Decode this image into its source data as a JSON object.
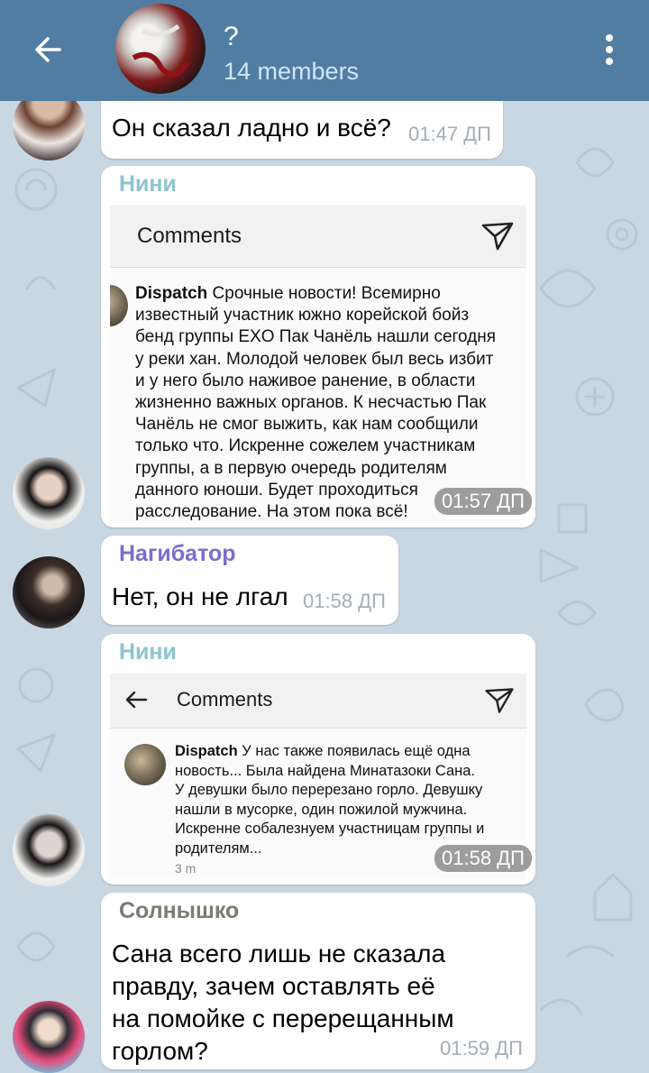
{
  "header": {
    "title": "?",
    "subtitle": "14 members"
  },
  "messages": [
    {
      "text": "Он сказал ладно и всё?",
      "time": "01:47 ДП"
    },
    {
      "sender": "Нини",
      "sender_color": "#8cc4d0",
      "time": "01:57 ДП",
      "screenshot": {
        "title": "Comments",
        "author": "Dispatch",
        "body_lines": [
          "Срочные новости! Всемирно",
          "известный участник южно корейской бойз",
          "бенд группы EXO Пак Чанёль нашли сегодня",
          "у реки хан. Молодой человек был весь избит",
          "и у него было наживое ранение, в области",
          "жизненно важных органов. К несчастью Пак",
          "Чанёль не смог выжить, как нам сообщили",
          "только что. Искренне сожелем участникам",
          "группы, а в первую очередь родителям",
          "данного юноши. Будет проходиться",
          "расследование. На этом пока всё!"
        ]
      }
    },
    {
      "sender": "Нагибатор",
      "sender_color": "#7c6ccd",
      "text": "Нет, он не лгал",
      "time": "01:58 ДП"
    },
    {
      "sender": "Нини",
      "sender_color": "#8cc4d0",
      "time": "01:58 ДП",
      "screenshot": {
        "title": "Comments",
        "author": "Dispatch",
        "body_lines": [
          "У нас также появилась ещё одна",
          "новость... Была найдена Минатазоки Сана.",
          "У девушки было перерезано горло. Девушку",
          "нашли в мусорке, один пожилой мужчина.",
          "Искренне собалезнуем участницам группы и",
          "родителям..."
        ],
        "age": "3 m"
      }
    },
    {
      "sender": "Солнышко",
      "sender_color": "#7e7a72",
      "text_lines": [
        "Сана всего лишь не сказала",
        "правду, зачем оставлять её",
        "на помойке с перерещанным",
        "горлом?"
      ],
      "time": "01:59 ДП"
    }
  ],
  "colors": {
    "header_bg": "#517da2",
    "chat_bg": "#c9d7e3",
    "bubble_bg": "#ffffff",
    "time_color": "#a4adb5"
  },
  "icons": [
    "back-arrow-icon",
    "more-vertical-icon",
    "send-plane-icon"
  ]
}
